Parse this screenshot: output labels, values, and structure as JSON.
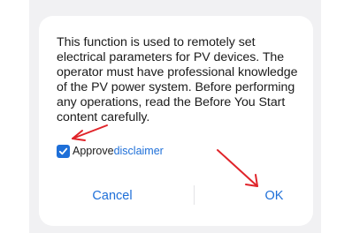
{
  "dialog": {
    "message": "This function is used to remotely set electrical parameters for PV devices. The operator must have professional knowledge of the PV power system. Before performing any operations, read the Before You Start content carefully.",
    "approve": {
      "checked": true,
      "label": "Approve",
      "link_text": "disclaimer"
    },
    "buttons": {
      "cancel_label": "Cancel",
      "ok_label": "OK"
    }
  },
  "colors": {
    "accent": "#1e6fd8",
    "annotation_arrow": "#e0242a"
  }
}
